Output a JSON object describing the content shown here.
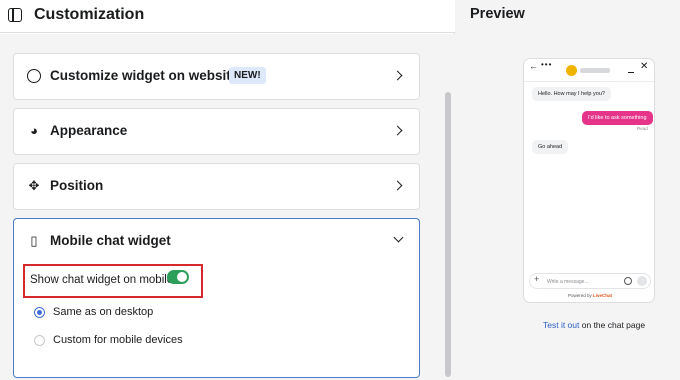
{
  "header": {
    "title": "Customization"
  },
  "cards": [
    {
      "title": "Customize widget on website",
      "badge": "NEW!"
    },
    {
      "title": "Appearance"
    },
    {
      "title": "Position"
    },
    {
      "title": "Mobile chat widget"
    }
  ],
  "mobile": {
    "toggle_label": "Show chat widget on mobile",
    "toggle_on": true,
    "options": [
      {
        "label": "Same as on desktop",
        "selected": true
      },
      {
        "label": "Custom for mobile devices",
        "selected": false
      }
    ]
  },
  "preview": {
    "title": "Preview",
    "messages": [
      {
        "from": "agent",
        "text": "Hello. How may I help you?"
      },
      {
        "from": "visitor",
        "text": "I'd like to ask something"
      },
      {
        "from": "agent",
        "text": "Go ahead"
      }
    ],
    "read_label": "Read",
    "composer_placeholder": "Write a message...",
    "powered_prefix": "Powered by",
    "powered_brand": "LiveChat",
    "test_link": "Test it out",
    "test_suffix": " on the chat page"
  },
  "colors": {
    "toggle_on": "#2e9e5b",
    "radio": "#3f6fd8",
    "highlight": "#d62929",
    "visitor_bubble": "#e5348a",
    "link": "#2d5fc4"
  }
}
